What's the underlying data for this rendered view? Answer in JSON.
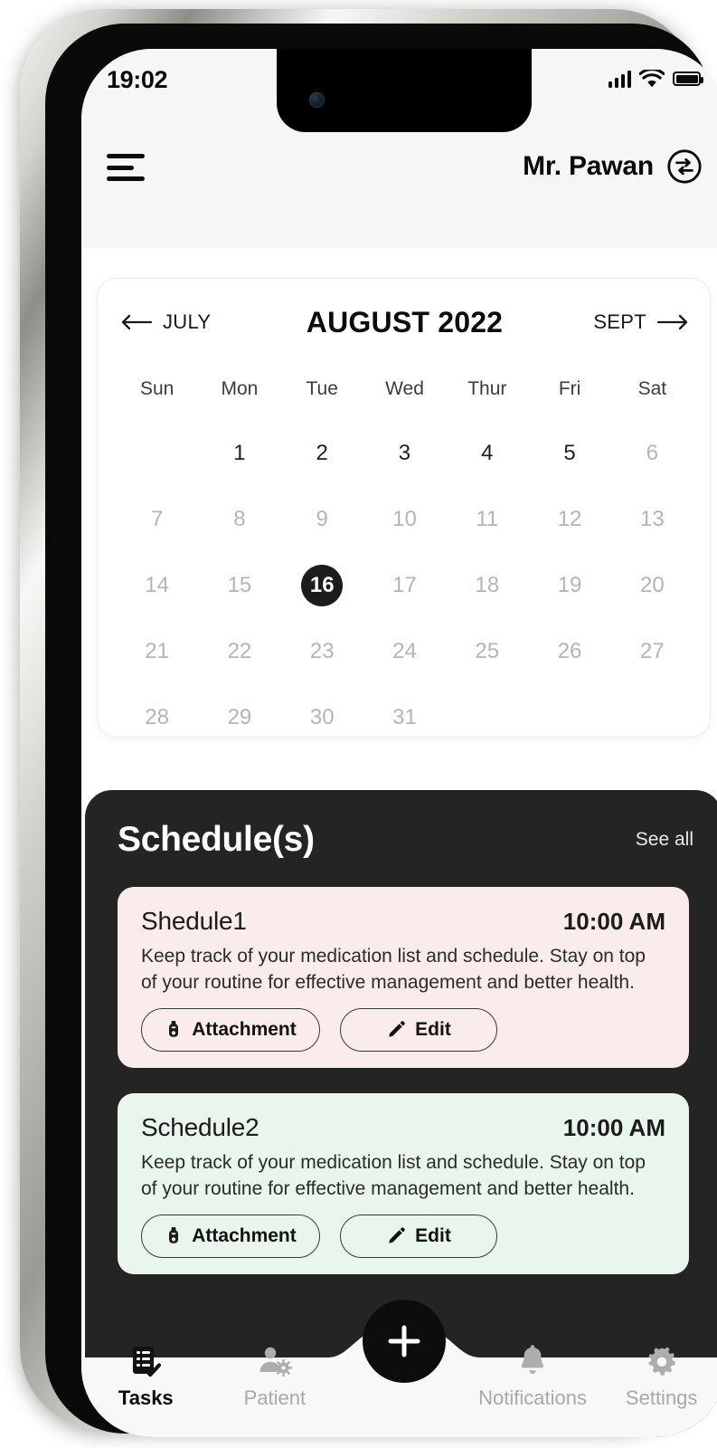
{
  "status_bar": {
    "time": "19:02",
    "signal_icon": "cellular-signal-icon",
    "wifi_icon": "wifi-icon",
    "battery_icon": "battery-icon"
  },
  "header": {
    "menu_icon": "hamburger-menu-icon",
    "user_name": "Mr. Pawan",
    "switch_icon": "switch-account-icon"
  },
  "calendar": {
    "prev_label": "JULY",
    "prev_arrow": "arrow-left-icon",
    "month_title": "AUGUST 2022",
    "next_label": "SEPT",
    "next_arrow": "arrow-right-icon",
    "weekdays": [
      "Sun",
      "Mon",
      "Tue",
      "Wed",
      "Thur",
      "Fri",
      "Sat"
    ],
    "leading_blanks": 1,
    "selected_day": 16,
    "strong_until": 5,
    "days": [
      1,
      2,
      3,
      4,
      5,
      6,
      7,
      8,
      9,
      10,
      11,
      12,
      13,
      14,
      15,
      16,
      17,
      18,
      19,
      20,
      21,
      22,
      23,
      24,
      25,
      26,
      27,
      28,
      29,
      30,
      31
    ]
  },
  "schedule": {
    "title": "Schedule(s)",
    "see_all": "See all",
    "panel_color": "#242424",
    "cards": [
      {
        "name": "Shedule1",
        "time": "10:00 AM",
        "description": "Keep track of your medication list and schedule. Stay on top of your routine for effective management and better health.",
        "attachment_label": "Attachment",
        "attachment_icon": "paperclip-icon",
        "edit_label": "Edit",
        "edit_icon": "pencil-icon",
        "background": "#f9ecea"
      },
      {
        "name": "Schedule2",
        "time": "10:00 AM",
        "description": "Keep track of your medication list and schedule. Stay on top of your routine for effective management and better health.",
        "attachment_label": "Attachment",
        "attachment_icon": "paperclip-icon",
        "edit_label": "Edit",
        "edit_icon": "pencil-icon",
        "background": "#e8f6ed"
      }
    ]
  },
  "bottom_nav": {
    "items": [
      {
        "label": "Tasks",
        "icon": "tasks-checklist-icon",
        "active": true
      },
      {
        "label": "Patient",
        "icon": "patient-virus-icon",
        "active": false
      },
      {
        "label": "Notifications",
        "icon": "bell-icon",
        "active": false
      },
      {
        "label": "Settings",
        "icon": "gear-icon",
        "active": false
      }
    ],
    "fab": {
      "icon": "plus-icon",
      "color": "#0d0d0d"
    }
  }
}
